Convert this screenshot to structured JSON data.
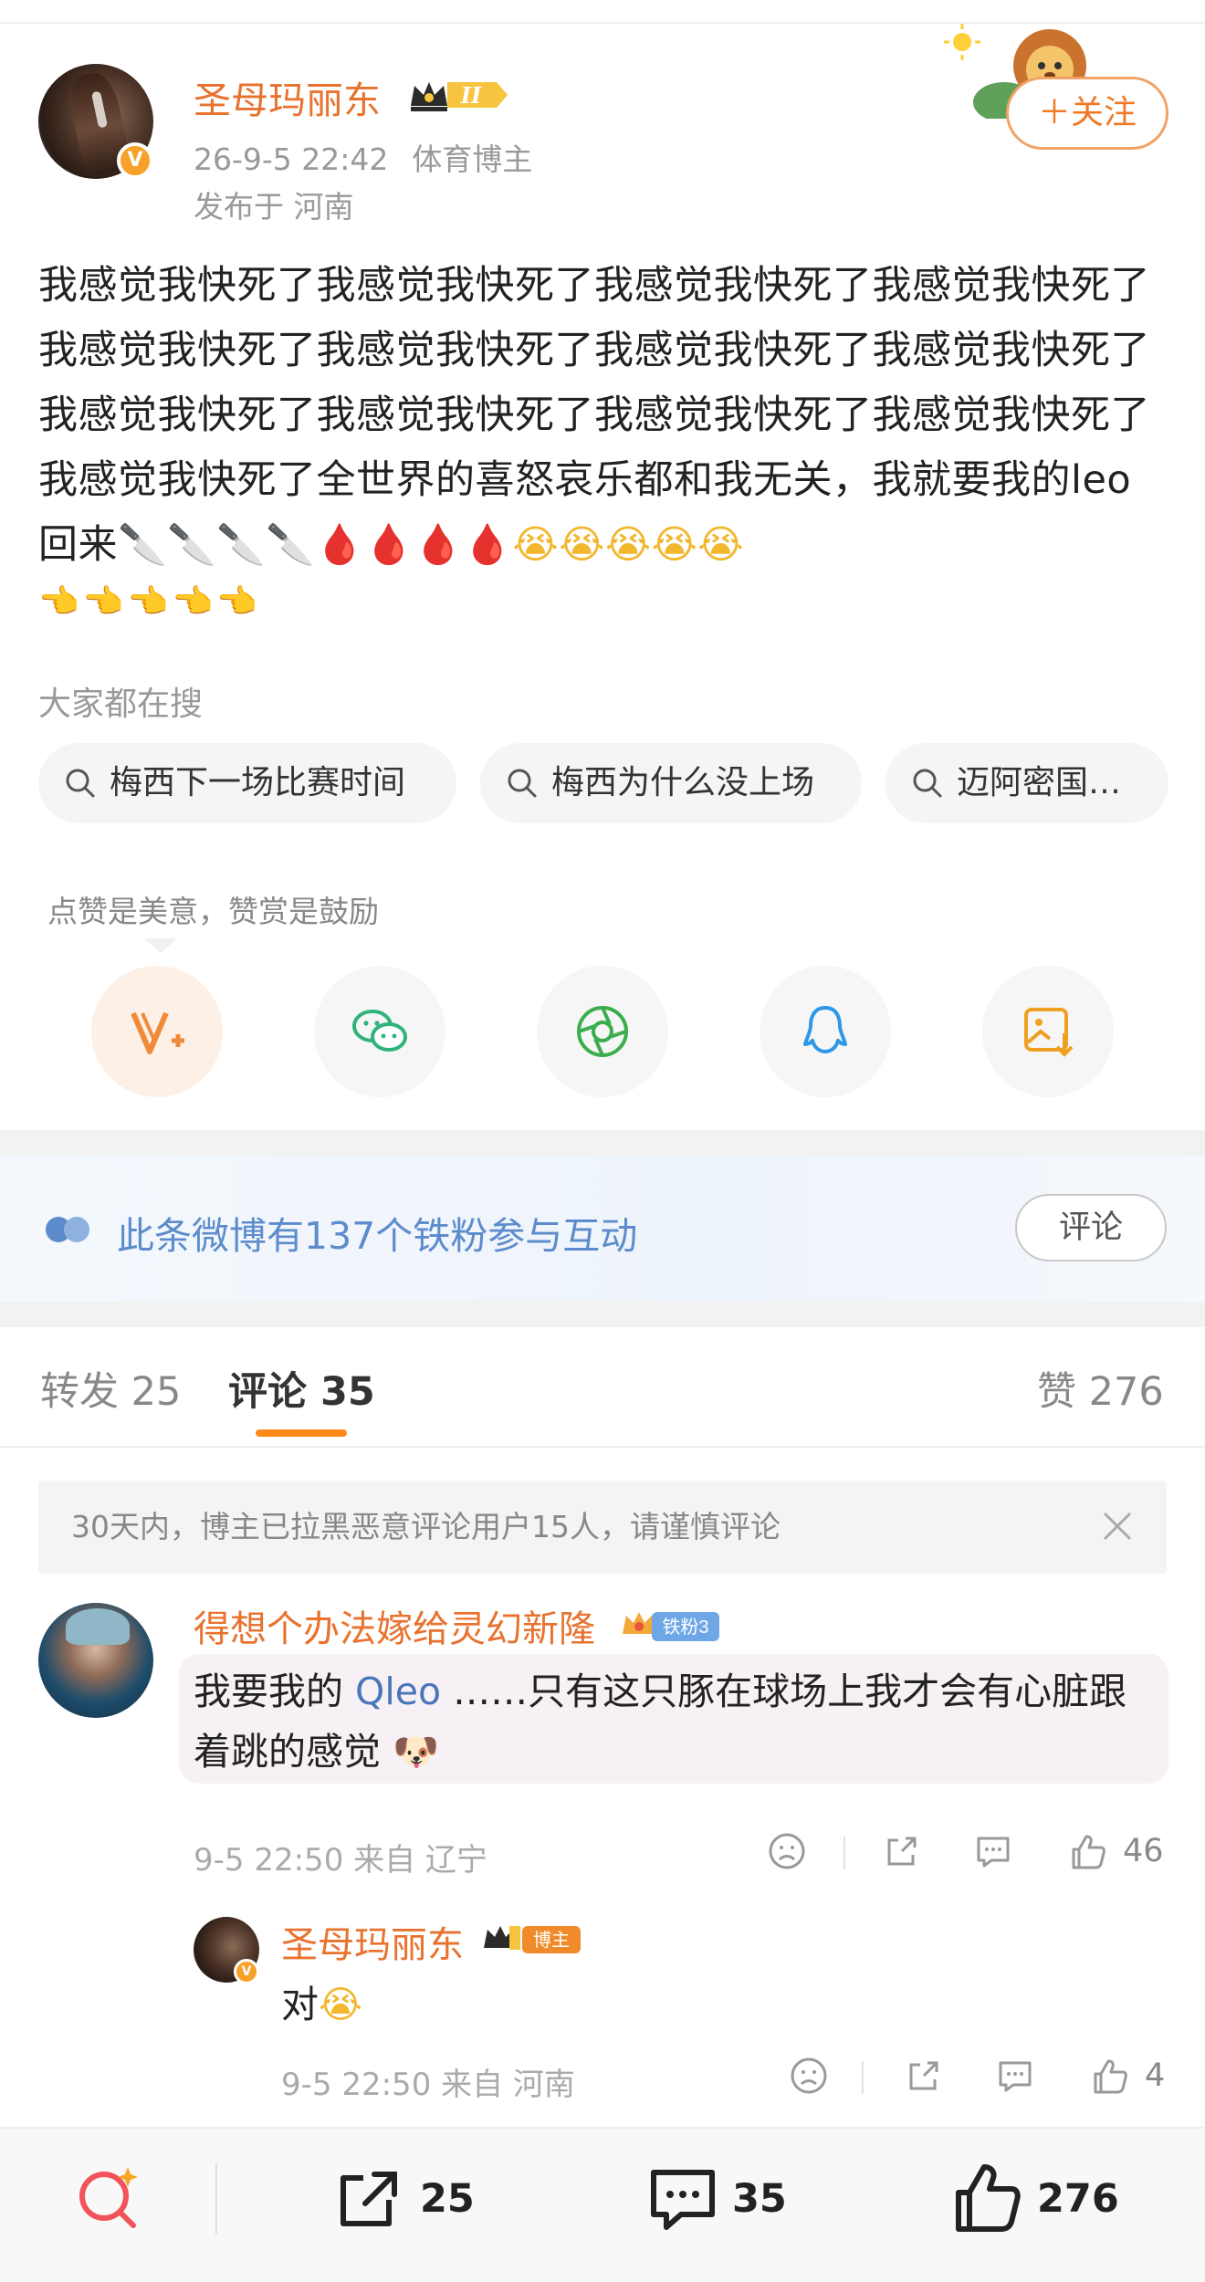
{
  "post": {
    "author": "圣母玛丽东",
    "time": "26-9-5 22:42",
    "tag": "体育博主",
    "location": "发布于 河南",
    "follow_label": "＋关注",
    "level_badge": "II",
    "text": "我感觉我快死了我感觉我快死了我感觉我快死了我感觉我快死了我感觉我快死了我感觉我快死了我感觉我快死了我感觉我快死了我感觉我快死了我感觉我快死了我感觉我快死了我感觉我快死了我感觉我快死了全世界的喜怒哀乐都和我无关，我就要我的leo回来",
    "emojis": {
      "knife": "🔪",
      "drop": "🩸",
      "cry": "😭",
      "hand": "👈"
    }
  },
  "search": {
    "title": "大家都在搜",
    "chips": [
      "梅西下一场比赛时间",
      "梅西为什么没上场",
      "迈阿密国…"
    ]
  },
  "share": {
    "tip": "点赞是美意，赞赏是鼓励",
    "buttons": [
      "reward",
      "wechat",
      "moments",
      "qq",
      "save-image"
    ]
  },
  "fans": {
    "text": "此条微博有137个铁粉参与互动",
    "button": "评论"
  },
  "tabs": {
    "repost_label": "转发",
    "repost_count": "25",
    "comment_label": "评论",
    "comment_count": "35",
    "like_label": "赞",
    "like_count": "276"
  },
  "notice": "30天内，博主已拉黑恶意评论用户15人，请谨慎评论",
  "comment": {
    "author": "得想个办法嫁给灵幻新隆",
    "badge": "铁粉3",
    "text_before": "我要我的",
    "link": "leo",
    "text_after": "……只有这只豚在球场上我才会有心脏跟着跳的感觉",
    "meta": "9-5 22:50 来自 辽宁",
    "likes": "46"
  },
  "reply": {
    "author": "圣母玛丽东",
    "badge": "博主",
    "text": "对",
    "meta": "9-5 22:50 来自 河南",
    "likes": "4"
  },
  "bottom_bar": {
    "repost": "25",
    "comment": "35",
    "like": "276"
  },
  "colors": {
    "accent": "#ff8a1a",
    "username": "#e8722e",
    "link": "#4a76b8",
    "fans_text": "#5d8ccc"
  }
}
